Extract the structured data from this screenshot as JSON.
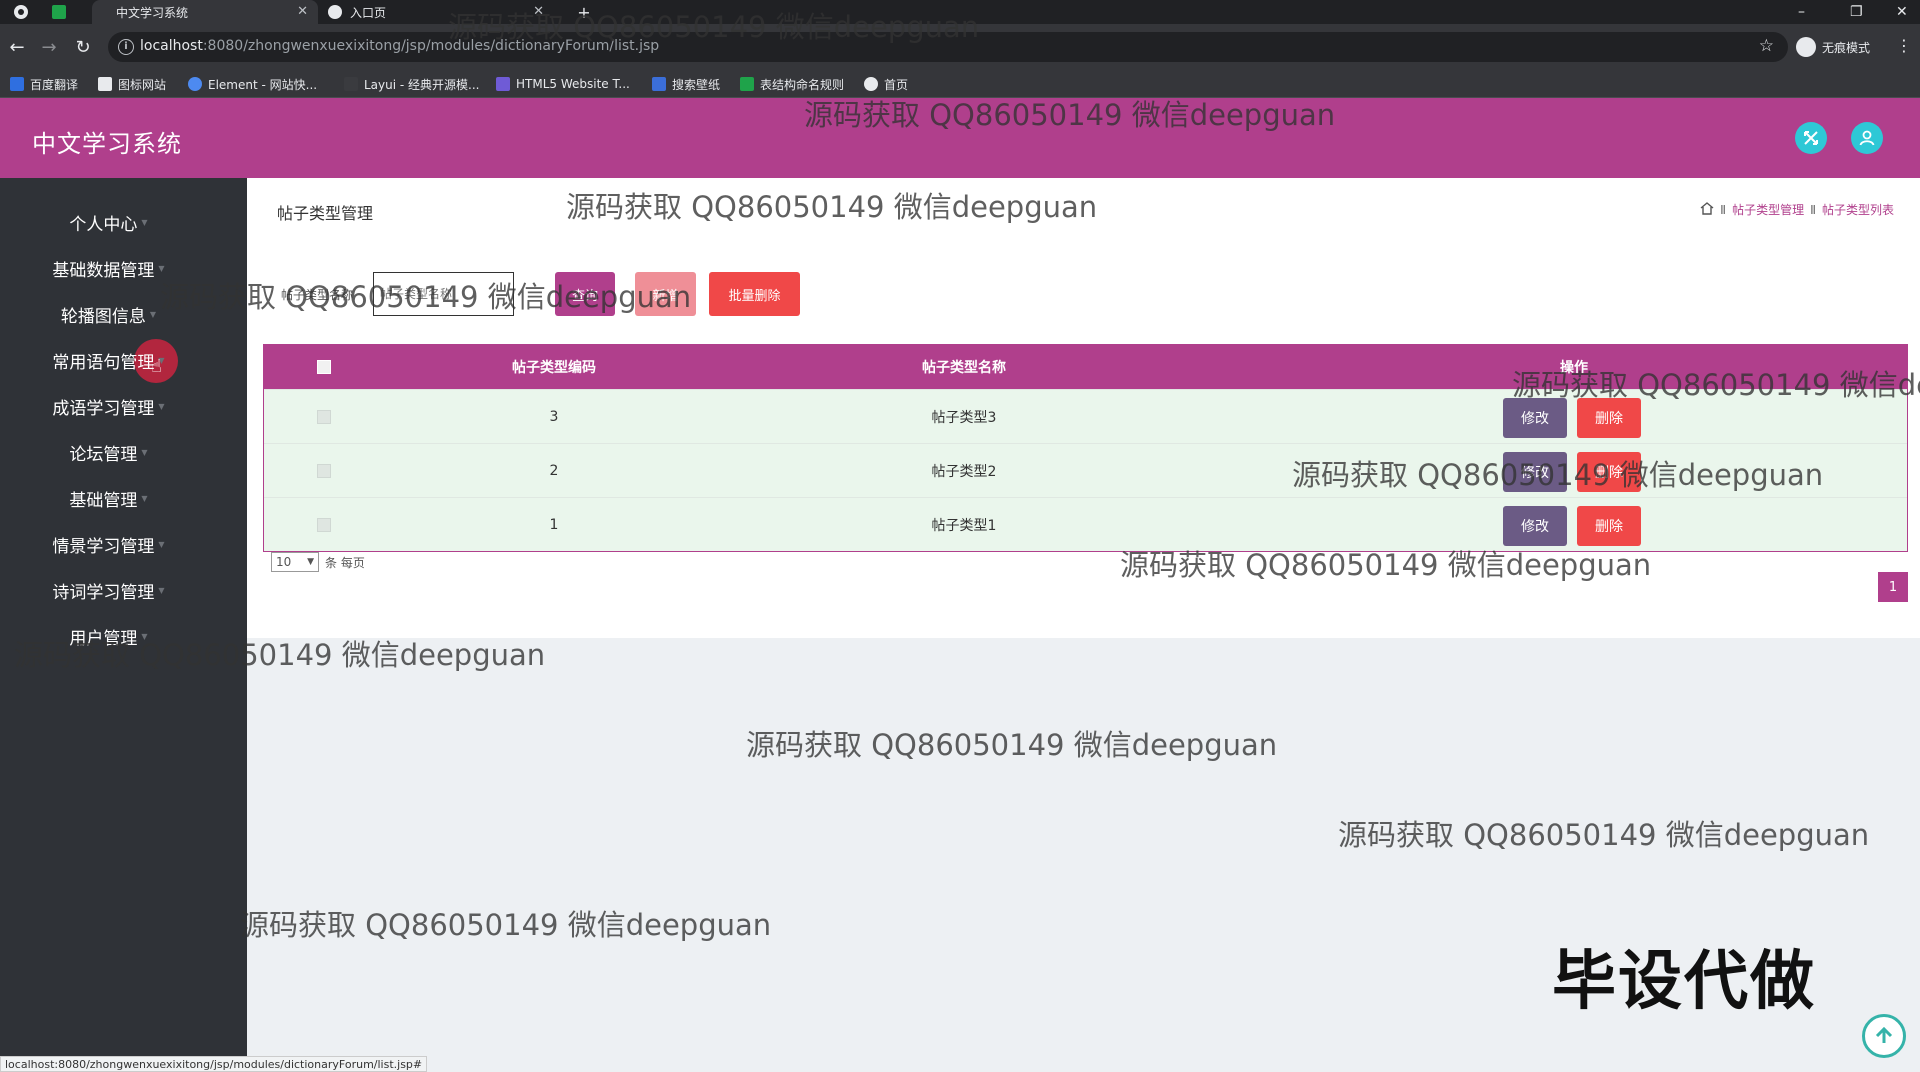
{
  "browser": {
    "tabs": [
      {
        "title": "中文学习系统",
        "active": true
      },
      {
        "title": "入口页",
        "active": false
      }
    ],
    "url_host": "localhost",
    "url_path": ":8080/zhongwenxuexixitong/jsp/modules/dictionaryForum/list.jsp",
    "incognito_label": "无痕模式",
    "bookmarks": [
      "百度翻译",
      "图标网站",
      "Element - 网站快...",
      "Layui - 经典开源模...",
      "HTML5 Website T...",
      "搜索壁纸",
      "表结构命名规则",
      "首页"
    ],
    "status_url": "localhost:8080/zhongwenxuexixitong/jsp/modules/dictionaryForum/list.jsp#"
  },
  "app": {
    "title": "中文学习系统"
  },
  "sidebar": {
    "items": [
      "个人中心",
      "基础数据管理",
      "轮播图信息",
      "常用语句管理",
      "成语学习管理",
      "论坛管理",
      "基础管理",
      "情景学习管理",
      "诗词学习管理",
      "用户管理"
    ]
  },
  "main": {
    "page_title": "帖子类型管理",
    "breadcrumb": [
      "帖子类型管理",
      "帖子类型列表"
    ],
    "search": {
      "label": "帖子类型名称",
      "placeholder": "帖子类型名称",
      "search_button": "查询",
      "add_button": "新增",
      "batch_delete_button": "批量删除"
    },
    "table": {
      "headers": [
        "帖子类型编码",
        "帖子类型名称",
        "操作"
      ],
      "rows": [
        {
          "code": "3",
          "name": "帖子类型3"
        },
        {
          "code": "2",
          "name": "帖子类型2"
        },
        {
          "code": "1",
          "name": "帖子类型1"
        }
      ],
      "edit_label": "修改",
      "delete_label": "删除"
    },
    "pagination": {
      "page_size": "10",
      "per_page_label": "条 每页",
      "current_page": "1"
    }
  },
  "overlay": {
    "watermark_text": "源码获取 QQ86050149 微信deepguan",
    "stamp_text": "毕设代做"
  },
  "colors": {
    "brand": "#b03f8c",
    "sidebar_bg": "#2f3237",
    "row_bg": "#eaf6ec",
    "edit_btn": "#6b5b85",
    "delete_btn": "#f04848",
    "header_icon": "#2ec8d6"
  }
}
